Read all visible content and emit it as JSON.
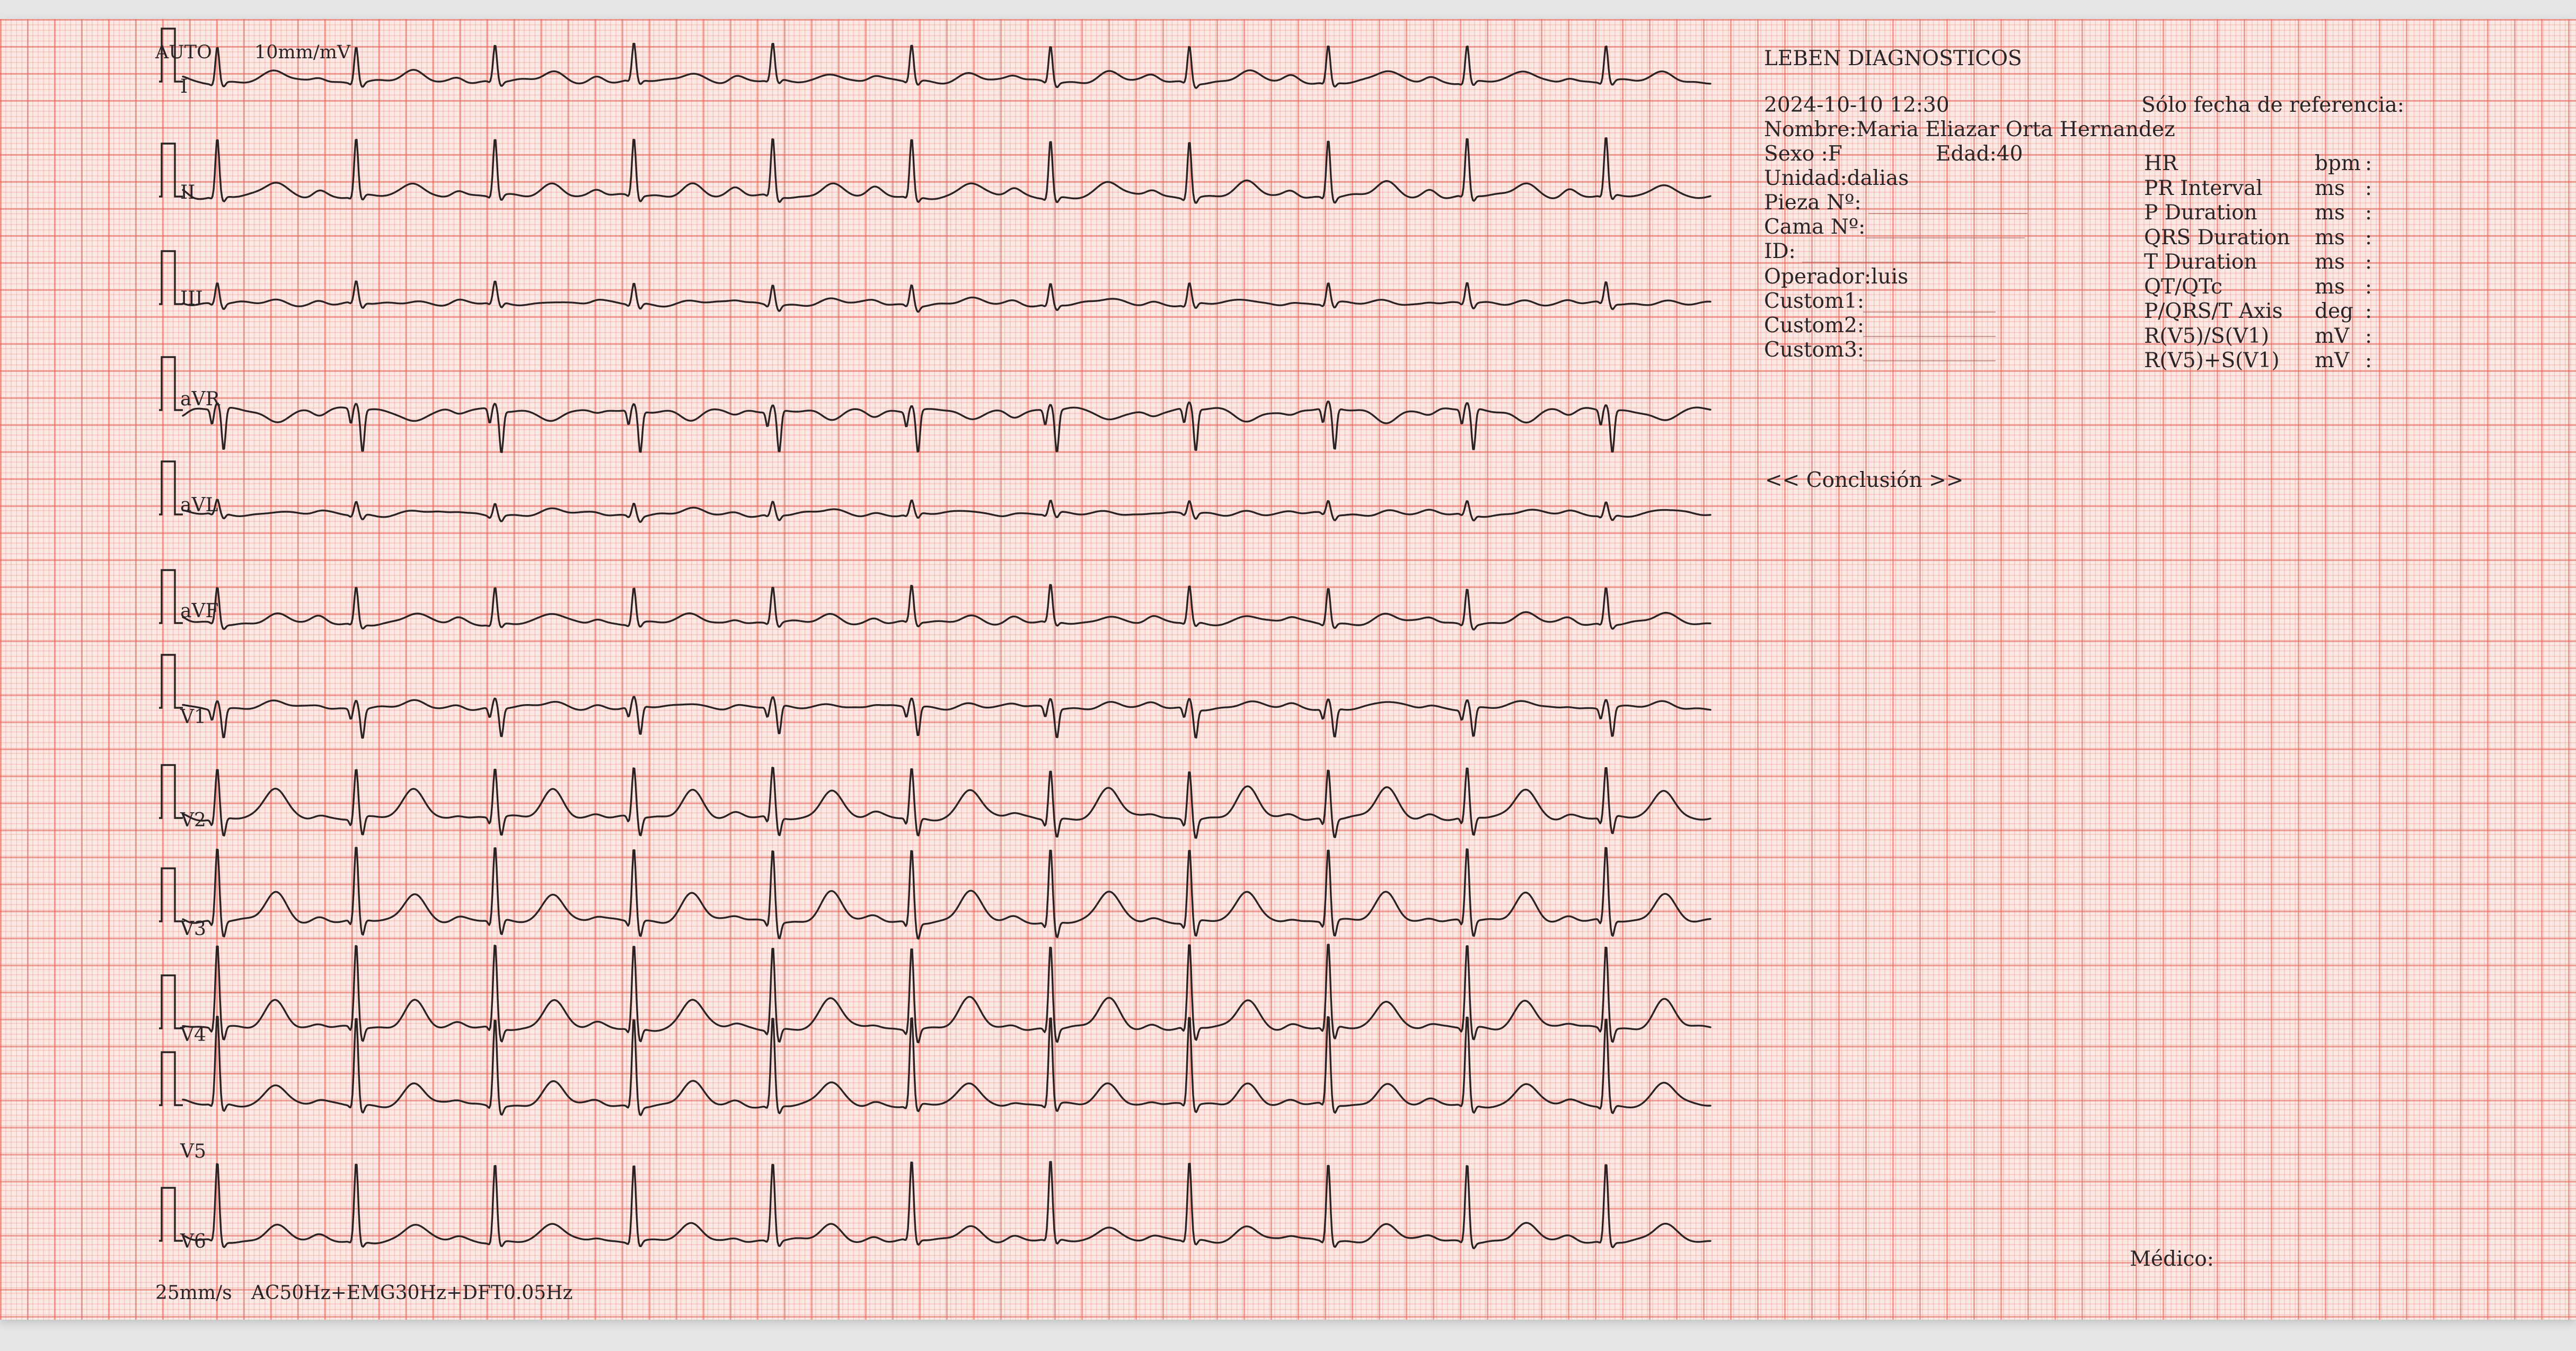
{
  "header": {
    "mode": "AUTO",
    "gain": "10mm/mV"
  },
  "leads": [
    "I",
    "II",
    "III",
    "aVR",
    "aVL",
    "aVF",
    "V1",
    "V2",
    "V3",
    "V4",
    "V5",
    "V6"
  ],
  "footer": {
    "speed": "25mm/s",
    "filters": "AC50Hz+EMG30Hz+DFT0.05Hz"
  },
  "info": {
    "institution": "LEBEN DIAGNOSTICOS",
    "datetime": "2024-10-10 12:30",
    "reference_note": "Sólo fecha de referencia:",
    "name": "Nombre:Maria Eliazar Orta Hernandez",
    "sex": "Sexo :F",
    "age": "Edad:40",
    "unit": "Unidad:dalias",
    "room": "Pieza Nº:",
    "bed": "Cama Nº:",
    "id": "ID:",
    "operator": "Operador:luis",
    "custom1": "Custom1:",
    "custom2": "Custom2:",
    "custom3": "Custom3:",
    "conclusion": "<< Conclusión >>",
    "doctor": "Médico:"
  },
  "measurements": [
    {
      "label": "HR",
      "unit": "bpm",
      "sep": ":"
    },
    {
      "label": "PR Interval",
      "unit": "ms",
      "sep": ":"
    },
    {
      "label": "P Duration",
      "unit": "ms",
      "sep": ":"
    },
    {
      "label": "QRS Duration",
      "unit": "ms",
      "sep": ":"
    },
    {
      "label": "T Duration",
      "unit": "ms",
      "sep": ":"
    },
    {
      "label": "QT/QTc",
      "unit": "ms",
      "sep": ":"
    },
    {
      "label": "P/QRS/T Axis",
      "unit": "deg",
      "sep": ":"
    },
    {
      "label": "R(V5)/S(V1)",
      "unit": "mV",
      "sep": ":"
    },
    {
      "label": "R(V5)+S(V1)",
      "unit": "mV",
      "sep": ":"
    }
  ],
  "colors": {
    "paper": "#fbe9e5",
    "grid_major": "#e86258",
    "grid_minor": "#f08c80",
    "trace": "#2b2224"
  }
}
